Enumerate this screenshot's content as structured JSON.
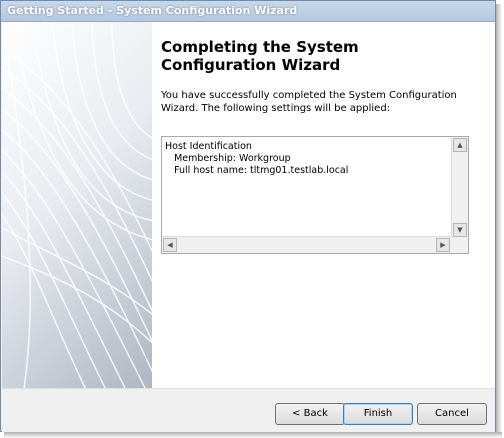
{
  "window": {
    "title": "Getting Started - System Configuration Wizard"
  },
  "content": {
    "heading": "Completing the System Configuration Wizard",
    "intro": "You have successfully completed the System Configuration Wizard. The following settings will be applied:",
    "settings": {
      "section": "Host Identification",
      "lines": [
        "Membership: Workgroup",
        "Full host name: tltmg01.testlab.local"
      ]
    }
  },
  "footer": {
    "back_label": "< Back",
    "finish_label": "Finish",
    "cancel_label": "Cancel"
  },
  "icons": {
    "scroll_up": "scroll-up-arrow-icon",
    "scroll_down": "scroll-down-arrow-icon",
    "scroll_left": "scroll-left-arrow-icon",
    "scroll_right": "scroll-right-arrow-icon"
  },
  "colors": {
    "accent": "#3c7fb1",
    "heading": "#000000"
  }
}
